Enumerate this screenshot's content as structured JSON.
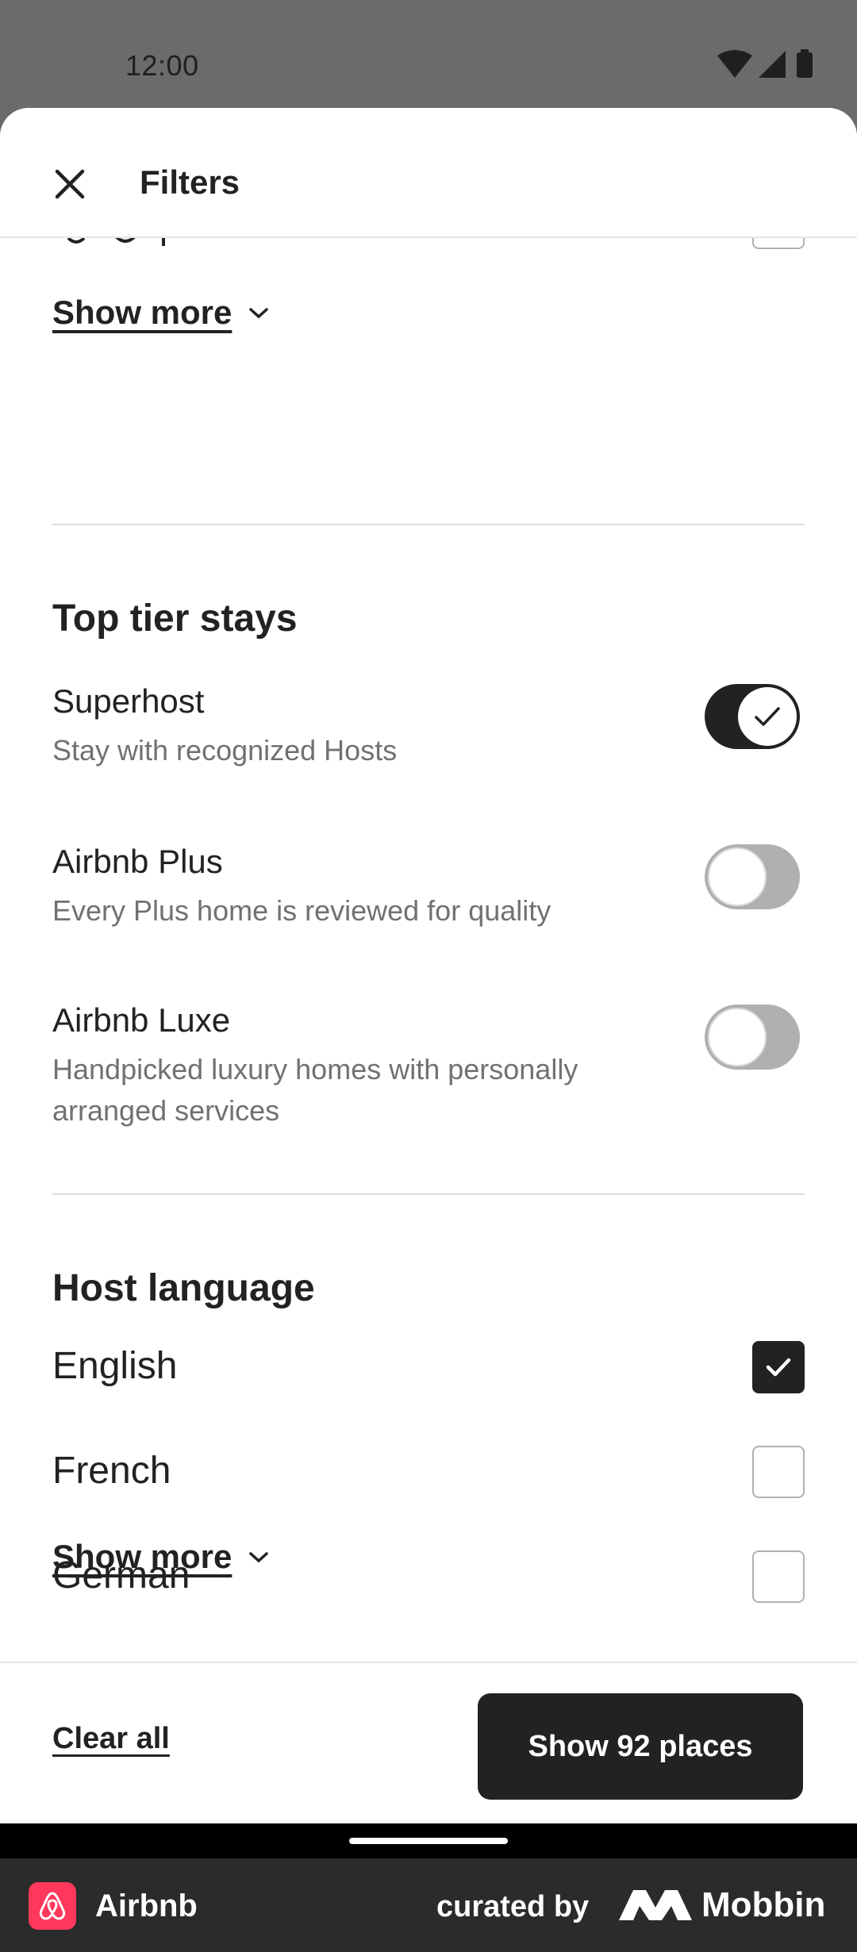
{
  "status_bar": {
    "time": "12:00"
  },
  "header": {
    "title": "Filters"
  },
  "sections": {
    "previous": {
      "show_more_label": "Show more"
    },
    "top_tier": {
      "title": "Top tier stays",
      "items": [
        {
          "label": "Superhost",
          "description": "Stay with recognized Hosts",
          "on": true
        },
        {
          "label": "Airbnb Plus",
          "description": "Every Plus home is reviewed for quality",
          "on": false
        },
        {
          "label": "Airbnb Luxe",
          "description": "Handpicked luxury homes with personally arranged services",
          "on": false
        }
      ]
    },
    "host_language": {
      "title": "Host language",
      "options": [
        {
          "label": "English",
          "checked": true
        },
        {
          "label": "French",
          "checked": false
        },
        {
          "label": "German",
          "checked": false
        }
      ],
      "show_more_label": "Show more"
    }
  },
  "footer": {
    "clear_label": "Clear all",
    "show_places_label": "Show 92 places"
  },
  "brand_bar": {
    "app_name": "Airbnb",
    "curated_label": "curated by",
    "curator_name": "Mobbin"
  },
  "colors": {
    "accent": "#222222",
    "airbnb_brand": "#ff385c",
    "toggle_off": "#b0b0b0",
    "muted_text": "#717171"
  }
}
